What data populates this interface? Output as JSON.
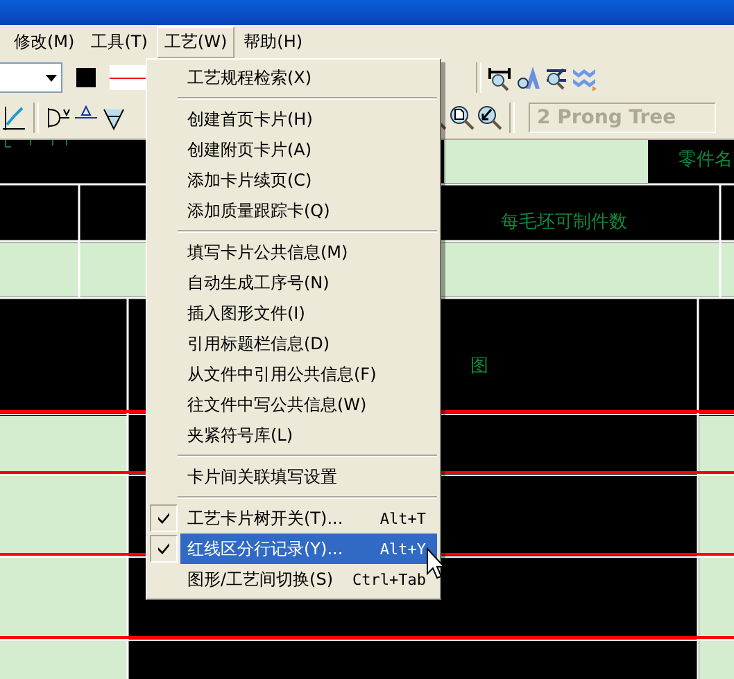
{
  "menubar": [
    {
      "label": "修改(M)",
      "selected": false
    },
    {
      "label": "工具(T)",
      "selected": false
    },
    {
      "label": "工艺(W)",
      "selected": true
    },
    {
      "label": "帮助(H)",
      "selected": false
    }
  ],
  "toolbar": {
    "style_field": {
      "value": "2 Prong Tree",
      "disabled": true
    }
  },
  "menu": {
    "items": [
      {
        "kind": "item",
        "label": "工艺规程检索(X)",
        "checked": false,
        "selected": false
      },
      {
        "kind": "separator"
      },
      {
        "kind": "item",
        "label": "创建首页卡片(H)",
        "checked": false,
        "selected": false
      },
      {
        "kind": "item",
        "label": "创建附页卡片(A)",
        "checked": false,
        "selected": false
      },
      {
        "kind": "item",
        "label": "添加卡片续页(C)",
        "checked": false,
        "selected": false
      },
      {
        "kind": "item",
        "label": "添加质量跟踪卡(Q)",
        "checked": false,
        "selected": false
      },
      {
        "kind": "separator"
      },
      {
        "kind": "item",
        "label": "填写卡片公共信息(M)",
        "checked": false,
        "selected": false
      },
      {
        "kind": "item",
        "label": "自动生成工序号(N)",
        "checked": false,
        "selected": false
      },
      {
        "kind": "item",
        "label": "插入图形文件(I)",
        "checked": false,
        "selected": false
      },
      {
        "kind": "item",
        "label": "引用标题栏信息(D)",
        "checked": false,
        "selected": false
      },
      {
        "kind": "item",
        "label": "从文件中引用公共信息(F)",
        "checked": false,
        "selected": false
      },
      {
        "kind": "item",
        "label": "往文件中写公共信息(W)",
        "checked": false,
        "selected": false
      },
      {
        "kind": "item",
        "label": "夹紧符号库(L)",
        "checked": false,
        "selected": false
      },
      {
        "kind": "separator"
      },
      {
        "kind": "item",
        "label": "卡片间关联填写设置",
        "checked": false,
        "selected": false
      },
      {
        "kind": "separator"
      },
      {
        "kind": "item",
        "label": "工艺卡片树开关(T)...",
        "shortcut": "Alt+T",
        "checked": true,
        "selected": false
      },
      {
        "kind": "item",
        "label": "红线区分行记录(Y)...",
        "shortcut": "Alt+Y",
        "checked": true,
        "selected": true
      },
      {
        "kind": "item",
        "label": "图形/工艺间切换(S)",
        "shortcut": "Ctrl+Tab",
        "checked": false,
        "selected": false
      }
    ]
  },
  "drawing": {
    "texts": [
      "零件名",
      "每毛坯可制件数",
      "图"
    ]
  }
}
